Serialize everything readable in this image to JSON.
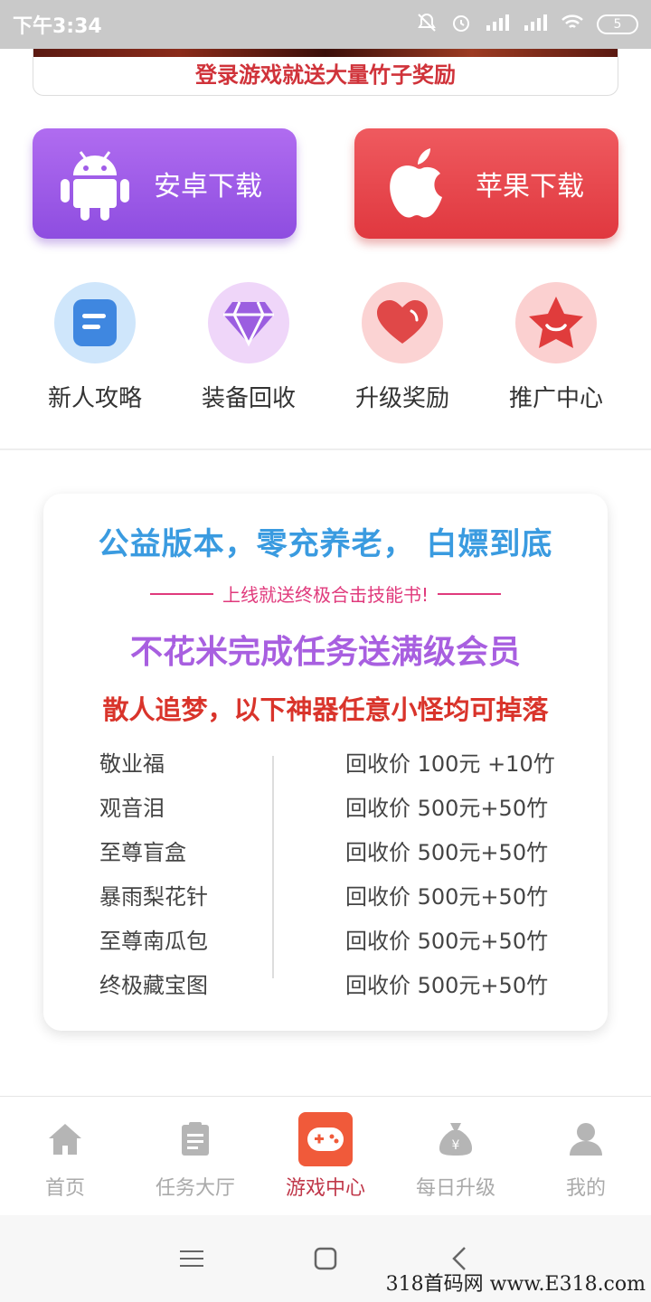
{
  "status_bar": {
    "time": "下午3:34",
    "battery": "5"
  },
  "banner": {
    "text": "登录游戏就送大量竹子奖励"
  },
  "downloads": {
    "android_label": "安卓下载",
    "apple_label": "苹果下载"
  },
  "quick_links": [
    {
      "label": "新人攻略",
      "icon": "doc-icon",
      "color": "#3f87e0"
    },
    {
      "label": "装备回收",
      "icon": "diamond-icon",
      "color": "#9b5ee0"
    },
    {
      "label": "升级奖励",
      "icon": "heart-icon",
      "color": "#e04848"
    },
    {
      "label": "推广中心",
      "icon": "star-icon",
      "color": "#e03c3c"
    }
  ],
  "promo": {
    "slogan": "公益版本，零充养老， 白嫖到底",
    "subtitle": "上线就送终极合击技能书!",
    "vip": "不花米完成任务送满级会员",
    "drop": "散人追梦，以下神器任意小怪均可掉落",
    "items": [
      {
        "name": "敬业福",
        "price": "回收价 100元 +10竹"
      },
      {
        "name": "观音泪",
        "price": "回收价 500元+50竹"
      },
      {
        "name": "至尊盲盒",
        "price": "回收价 500元+50竹"
      },
      {
        "name": "暴雨梨花针",
        "price": "回收价 500元+50竹"
      },
      {
        "name": "至尊南瓜包",
        "price": "回收价 500元+50竹"
      },
      {
        "name": "终极藏宝图",
        "price": "回收价 500元+50竹"
      }
    ]
  },
  "tabs": [
    {
      "label": "首页",
      "icon": "home-icon"
    },
    {
      "label": "任务大厅",
      "icon": "clipboard-icon"
    },
    {
      "label": "游戏中心",
      "icon": "gamepad-icon",
      "active": true
    },
    {
      "label": "每日升级",
      "icon": "money-bag-icon"
    },
    {
      "label": "我的",
      "icon": "user-icon"
    }
  ],
  "watermark": "318首码网 www.E318.com"
}
